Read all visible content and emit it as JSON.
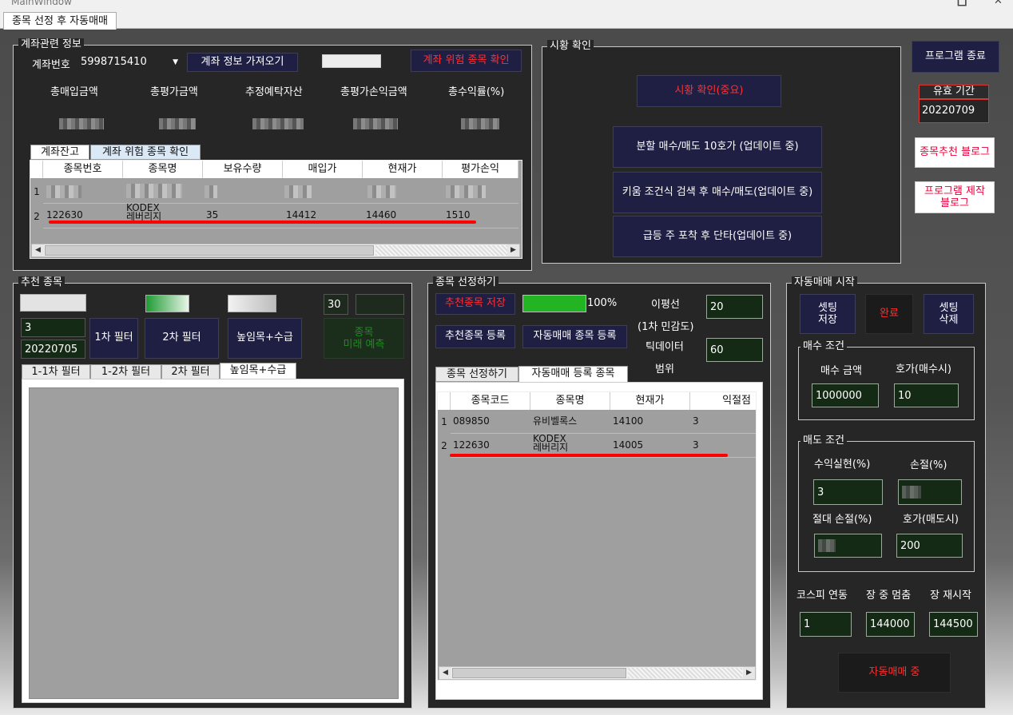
{
  "window": {
    "title": "MainWindow",
    "minimize_glyph": "🗖",
    "close_glyph": "✕"
  },
  "main_tab": "종목 선정 후 자동매매",
  "account": {
    "group_label": "계좌관련 정보",
    "account_label": "계좌번호",
    "account_number": "5998715410",
    "fetch_button": "계좌 정보 가져오기",
    "risk_button": "계좌 위험 종목 확인",
    "summary_headers": [
      "총매입금액",
      "총평가금액",
      "추정예탁자산",
      "총평가손익금액",
      "총수익률(%)"
    ],
    "tabs": [
      "계좌잔고",
      "계좌 위험 종목 확인"
    ],
    "table_headers": [
      "종목번호",
      "종목명",
      "보유수량",
      "매입가",
      "현재가",
      "평가손익"
    ],
    "rows": [
      {
        "num": "1",
        "code": "",
        "name": "",
        "qty": "",
        "buy": "",
        "cur": "",
        "pl": ""
      },
      {
        "num": "2",
        "code": "122630",
        "name": "KODEX\n레버리지",
        "qty": "35",
        "buy": "14412",
        "cur": "14460",
        "pl": "1510"
      }
    ]
  },
  "market": {
    "group_label": "시황 확인",
    "check_button": "시황 확인(중요)",
    "split_button": "분할 매수/매도 10호가 (업데이트 중)",
    "kiwoom_button": "키움 조건식 검색 후 매수/매도(업데이트 중)",
    "surge_button": "급등 주 포착 후 단타(업데이트 중)"
  },
  "side": {
    "exit_button": "프로그램 종료",
    "validity_label": "유효 기간",
    "validity_value": "20220709",
    "blog_recommend": "종목추천 블로그",
    "blog_program": "프로그램 제작\n블로그"
  },
  "recommend": {
    "group_label": "추천 종목",
    "count_value": "30",
    "input_value": "3",
    "date_value": "20220705",
    "filter1_button": "1차 필터",
    "filter2_button": "2차 필터",
    "volume_button": "높임목+수급",
    "predict_button": "종목\n미래 예측",
    "tabs": [
      "1-1차 필터",
      "1-2차 필터",
      "2차 필터",
      "높임목+수급"
    ]
  },
  "selection": {
    "group_label": "종목 선정하기",
    "save_button": "추천종목 저장",
    "progress_percent": 100,
    "progress_label": "100%",
    "register_button": "추천종목 등록",
    "auto_register_button": "자동매매 종목 등록",
    "ma_label": "이평선",
    "ma_sub_label": "(1차 민감도)",
    "ma_value": "20",
    "tick_label": "틱데이터",
    "tick_sub_label": "범위",
    "tick_value": "60",
    "tabs": [
      "종목 선정하기",
      "자동매매 등록 종목"
    ],
    "table_headers": [
      "종목코드",
      "종목명",
      "현재가",
      "익절점"
    ],
    "rows": [
      {
        "num": "1",
        "code": "089850",
        "name": "유비벨록스",
        "cur": "14100",
        "tp": "3"
      },
      {
        "num": "2",
        "code": "122630",
        "name": "KODEX\n레버리지",
        "cur": "14005",
        "tp": "3"
      }
    ]
  },
  "auto": {
    "group_label": "자동매매 시작",
    "setting_save": "셋팅\n저장",
    "complete": "완료",
    "setting_delete": "셋팅\n삭제",
    "buy_group": "매수 조건",
    "buy_amount_label": "매수 금액",
    "buy_tick_label": "호가(매수시)",
    "buy_amount_value": "1000000",
    "buy_tick_value": "10",
    "sell_group": "매도 조건",
    "profit_label": "수익실현(%)",
    "loss_label": "손절(%)",
    "profit_value": "3",
    "abs_loss_label": "절대 손절(%)",
    "sell_tick_label": "호가(매도시)",
    "sell_tick_value": "200",
    "kospi_label": "코스피 연동",
    "pause_label": "장 중 멈춤",
    "restart_label": "장 재시작",
    "kospi_value": "1",
    "pause_value": "144000",
    "restart_value": "144500",
    "running_button": "자동매매 중"
  },
  "colors": {
    "highlight_red": "#ff0000",
    "button_navy": "#1f1f44",
    "field_green": "#142a14",
    "progress_green": "#22b422"
  }
}
